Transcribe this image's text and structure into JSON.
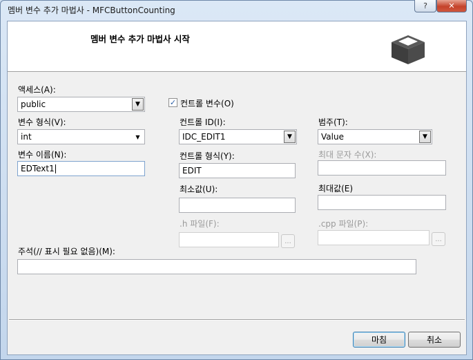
{
  "window": {
    "title": "멤버 변수 추가 마법사 - MFCButtonCounting",
    "help_label": "?",
    "close_label": "✕"
  },
  "header": {
    "title": "멤버 변수 추가 마법사 시작",
    "icon": "variable-box-icon"
  },
  "access": {
    "label": "액세스(A):",
    "value": "public"
  },
  "var_type": {
    "label": "변수 형식(V):",
    "value": "int"
  },
  "var_name": {
    "label": "변수 이름(N):",
    "value": "EDText1"
  },
  "control_var": {
    "label": "컨트롤 변수(O)",
    "checked": true,
    "mark": "✓"
  },
  "control_id": {
    "label": "컨트롤 ID(I):",
    "value": "IDC_EDIT1"
  },
  "category": {
    "label": "범주(T):",
    "value": "Value"
  },
  "control_type": {
    "label": "컨트롤 형식(Y):",
    "value": "EDIT"
  },
  "max_chars": {
    "label": "최대 문자 수(X):",
    "value": ""
  },
  "min_value": {
    "label": "최소값(U):",
    "value": ""
  },
  "max_value": {
    "label": "최대값(E)",
    "value": ""
  },
  "h_file": {
    "label": ".h 파일(F):",
    "value": "",
    "browse_label": "..."
  },
  "cpp_file": {
    "label": ".cpp 파일(P):",
    "value": "",
    "browse_label": "..."
  },
  "comment": {
    "label": "주석(// 표시 필요 없음)(M):",
    "value": ""
  },
  "buttons": {
    "finish": "마침",
    "cancel": "취소"
  }
}
